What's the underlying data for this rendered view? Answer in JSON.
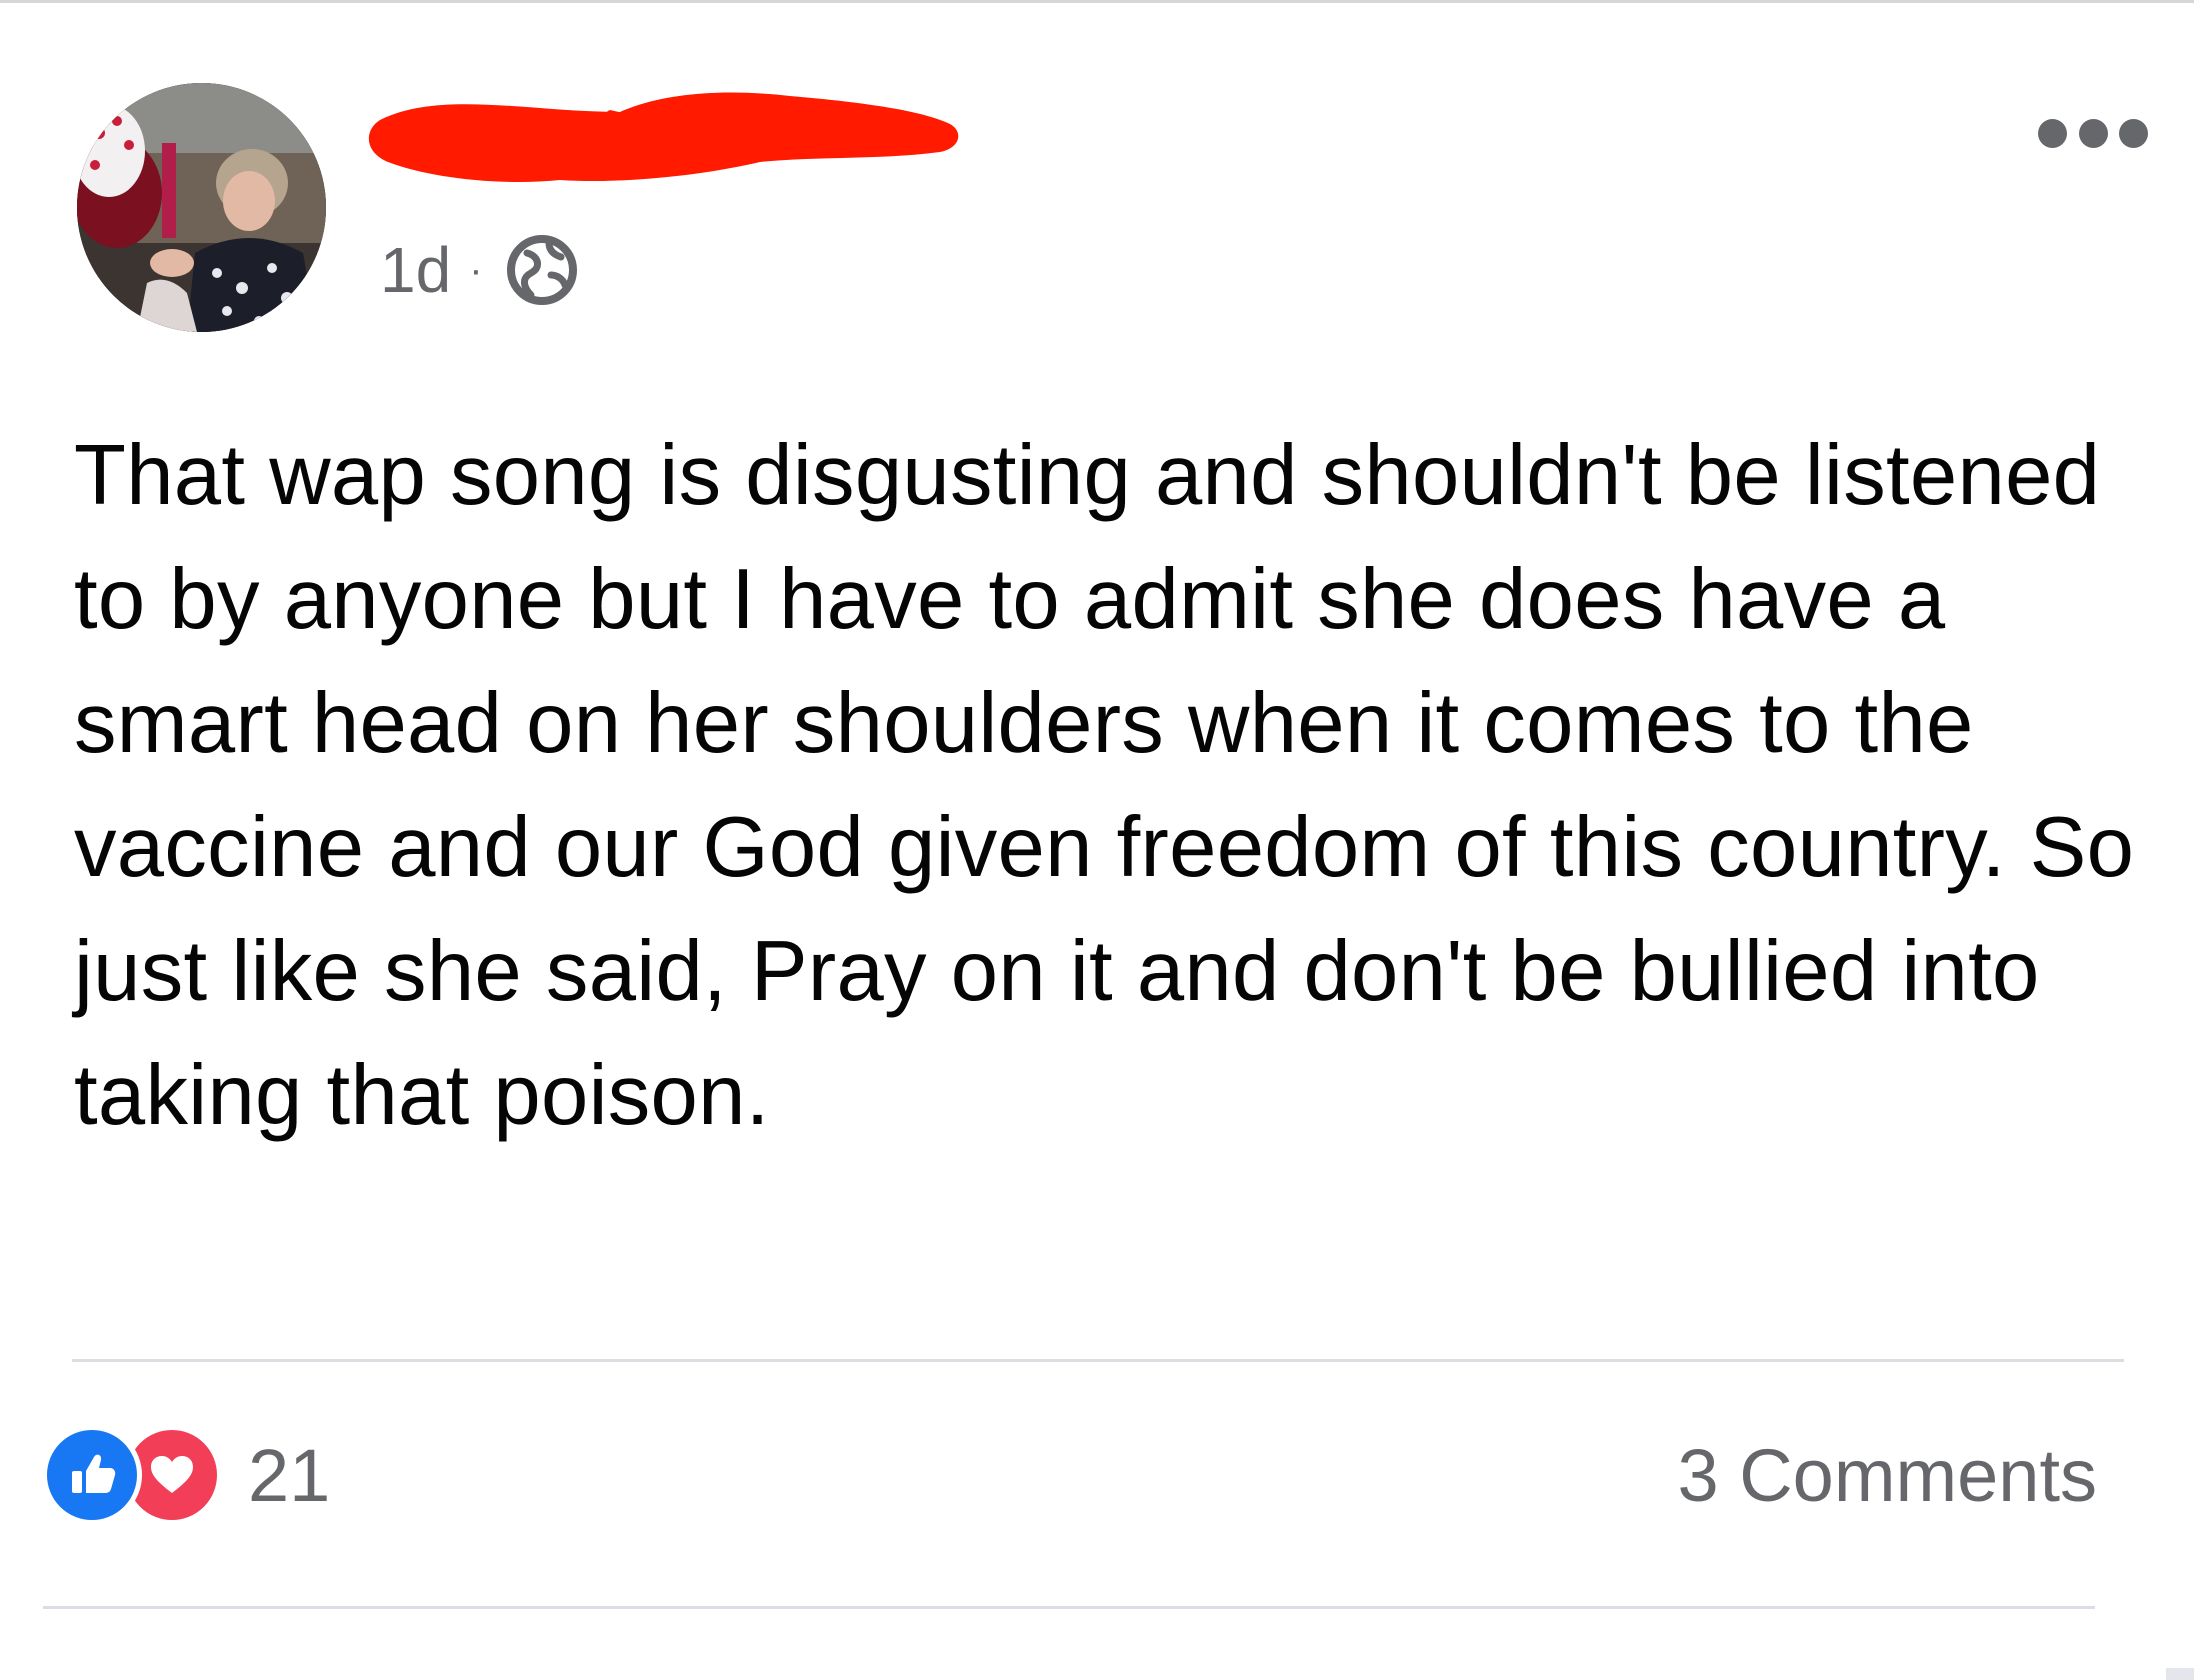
{
  "post": {
    "timestamp": "1d",
    "separator": "·",
    "privacy_icon": "globe-icon",
    "more_icon": "more-horizontal-icon",
    "text": "That wap song is disgusting and shouldn't be listened to by anyone but I have to admit she does have a smart head on her shoulders when it comes to the vaccine and our God given freedom of this country. So just like she said, Pray on it and don't be bullied into taking that poison."
  },
  "reactions": {
    "icons": [
      "like-icon",
      "love-icon"
    ],
    "count": "21"
  },
  "comments": {
    "label": "3 Comments"
  },
  "colors": {
    "like": "#1877f2",
    "love": "#f33e58",
    "secondary_text": "#65676b",
    "redaction": "#ff1a00"
  }
}
